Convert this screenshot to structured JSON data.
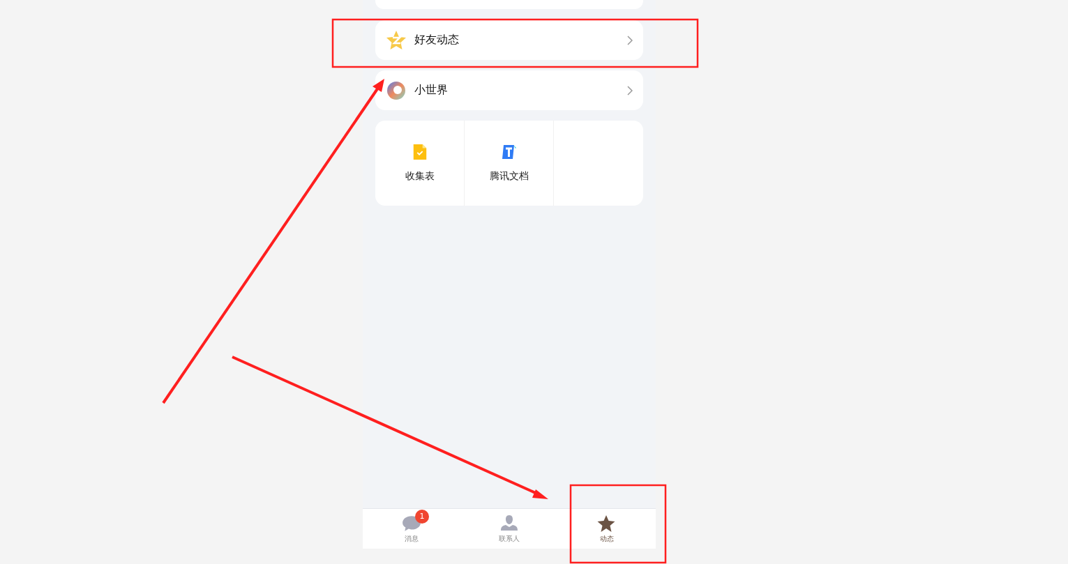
{
  "menu_rows": [
    {
      "kind": "star",
      "label": "好友动态"
    },
    {
      "kind": "ring",
      "label": "小世界"
    }
  ],
  "apps": [
    {
      "kind": "form",
      "label": "收集表"
    },
    {
      "kind": "docs",
      "label": "腾讯文档"
    }
  ],
  "tab_bar": [
    {
      "kind": "chat",
      "label": "消息",
      "badge": "1",
      "selected": false
    },
    {
      "kind": "person",
      "label": "联系人",
      "selected": false
    },
    {
      "kind": "star",
      "label": "动态",
      "selected": true
    }
  ]
}
